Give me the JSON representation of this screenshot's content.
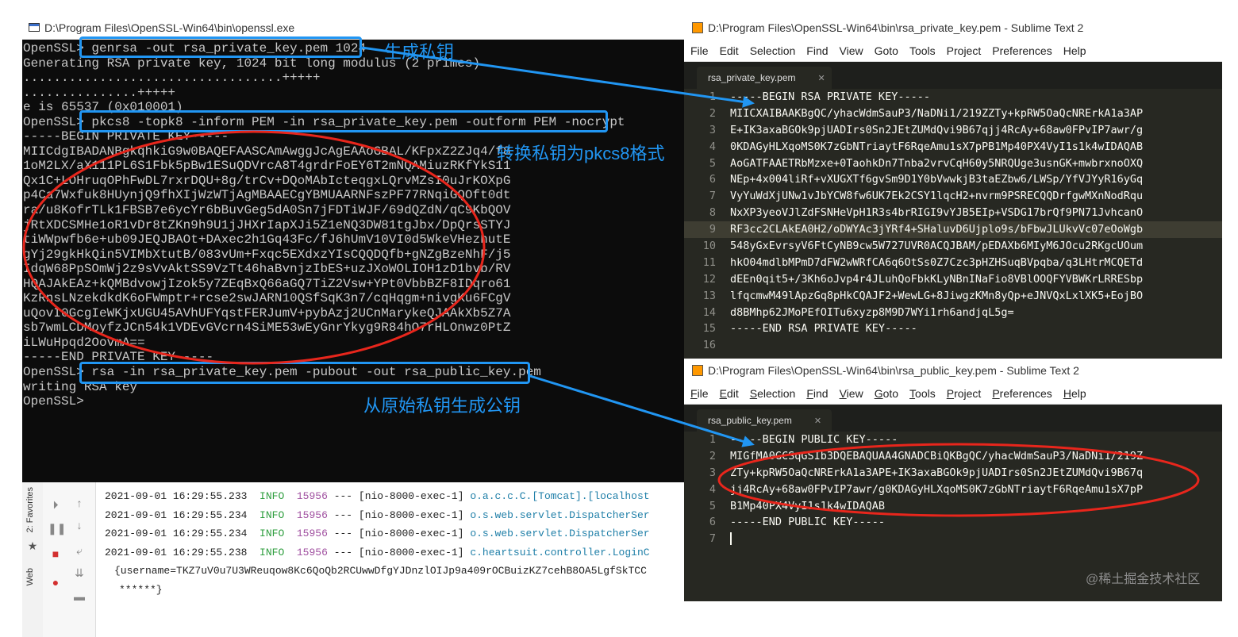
{
  "cmd": {
    "title": "D:\\Program Files\\OpenSSL-Win64\\bin\\openssl.exe",
    "lines": [
      "OpenSSL> genrsa -out rsa_private_key.pem 1024",
      "Generating RSA private key, 1024 bit long modulus (2 primes)",
      "..................................+++++",
      "...............+++++",
      "e is 65537 (0x010001)",
      "OpenSSL> pkcs8 -topk8 -inform PEM -in rsa_private_key.pem -outform PEM -nocrypt",
      "-----BEGIN PRIVATE KEY-----",
      "MIICdgIBADANBgkqhkiG9w0BAQEFAASCAmAwggJcAgEAAoGBAL/KFpxZ2ZJq4/f8",
      "1oM2LX/aX111PL6S1Fbk5pBw1ESuQDVrcA8T4grdrFoEY6T2mNQAMiuzRKfYkS11",
      "Qx1C+LOHruqOPhFwDL7rxrDQU+8g/trCv+DQoMAbIcteqgxLQrvMZsI0uJrKOXpG",
      "p4Ca7Wxfuk8HUynjQ9fhXIjWzWTjAgMBAAECgYBMUAARNFszPF77RNqiGQOft0dt",
      "ra/u8KofrTLk1FBSB7e6ycYr6bBuvGeg5dA0Sn7jFDTiWJF/69dQZdN/qC9KbQOV",
      "jRtXDCSMHe1oR1vDr8tZKn9h9U1jJHXrIapXJi5Z1eNQ3DW81tgJbx/DpQrsSTYJ",
      "tiWWpwfb6e+ub09JEQJBAOt+DAxec2h1Gq43Fc/fJ6hUmV10VI0d5WkeVHezhutE",
      "gYj29gkHkQin5VIMbXtutB/083vUm+Fxqc5EXdxzYIsCQQDQfb+gNZgBzeNhF/j5",
      "IdqW68PpSOmWj2z9sVvAktSS9VzTt46haBvnjzIbES+uzJXoWOLIOH1zD1bvb/RV",
      "HQAJAkEAz+kQMBdvowjIzok5y7ZEqBxQ66aGQ7TiZ2Vsw+YPt0VbbBZF8IDqro61",
      "KzRnsLNzekdkdK6oFWmptr+rcse2swJARN10QSfSqK3n7/cqHqgm+nivgKu6FCgV",
      "uQovI0GcgIeWKjxUGU45AVhUFYqstFERJumV+pybAzj2UCnMarykeQJAAkXb5Z7A",
      "sb7wmLCDMoyfzJCn54k1VDEvGVcrn4SiME53wEyGnrYkyg9R84hO7rHLOnwz0PtZ",
      "iLWuHpqd2OovmA==",
      "-----END PRIVATE KEY-----",
      "OpenSSL> rsa -in rsa_private_key.pem -pubout -out rsa_public_key.pem",
      "writing RSA key",
      "OpenSSL>"
    ]
  },
  "annotations": {
    "gen_private": "生成私钥",
    "to_pkcs8": "转换私钥为pkcs8格式",
    "gen_public": "从原始私钥生成公钥"
  },
  "ide": {
    "tabs": [
      "2: Favorites",
      "Web"
    ],
    "logs": [
      {
        "ts": "2021-09-01 16:29:55.233",
        "level": "INFO",
        "pid": "15956",
        "thread": " --- [nio-8000-exec-1] ",
        "logger": "o.a.c.c.C.[Tomcat].[localhost"
      },
      {
        "ts": "2021-09-01 16:29:55.234",
        "level": "INFO",
        "pid": "15956",
        "thread": " --- [nio-8000-exec-1] ",
        "logger": "o.s.web.servlet.DispatcherSer"
      },
      {
        "ts": "2021-09-01 16:29:55.234",
        "level": "INFO",
        "pid": "15956",
        "thread": " --- [nio-8000-exec-1] ",
        "logger": "o.s.web.servlet.DispatcherSer"
      },
      {
        "ts": "2021-09-01 16:29:55.238",
        "level": "INFO",
        "pid": "15956",
        "thread": " --- [nio-8000-exec-1] ",
        "logger": "c.heartsuit.controller.LoginC"
      }
    ],
    "payload": "{username=TKZ7uV0u7U3WReuqow8Kc6QoQb2RCUwwDfgYJDnzlOIJp9a409rOCBuizKZ7cehB8OA5LgfSkTCC",
    "payload2": "******}"
  },
  "sublime_private": {
    "title": "D:\\Program Files\\OpenSSL-Win64\\bin\\rsa_private_key.pem - Sublime Text 2",
    "menu": [
      "File",
      "Edit",
      "Selection",
      "Find",
      "View",
      "Goto",
      "Tools",
      "Project",
      "Preferences",
      "Help"
    ],
    "tab": "rsa_private_key.pem",
    "lines": [
      "-----BEGIN RSA PRIVATE KEY-----",
      "MIICXAIBAAKBgQC/yhacWdmSauP3/NaDNi1/219ZZTy+kpRW5OaQcNRErkA1a3AP",
      "E+IK3axaBGOk9pjUADIrs0Sn2JEtZUMdQvi9B67qjj4RcAy+68aw0FPvIP7awr/g",
      "0KDAGyHLXqoMS0K7zGbNTriaytF6RqeAmu1sX7pPB1Mp40PX4VyI1s1k4wIDAQAB",
      "AoGATFAAETRbMzxe+0TaohkDn7Tnba2vrvCqH60y5NRQUge3usnGK+mwbrxnoOXQ",
      "NEp+4x004liRf+vXUGXTf6gvSm9D1Y0bVwwkjB3taEZbw6/LWSp/YfVJYyR16yGq",
      "VyYuWdXjUNw1vJbYCW8fw6UK7Ek2CSY1lqcH2+nvrm9PSRECQQDrfgwMXnNodRqu",
      "NxXP3yeoVJlZdFSNHeVpH1R3s4brRIGI9vYJB5EIp+VSDG17brQf9PN71JvhcanO",
      "RF3cc2CLAkEA0H2/oDWYAc3jYRf4+SHaluvD6Ujplo9s/bFbwJLUkvVc07eOoWgb",
      "548yGxEvrsyV6FtCyNB9cw5W727UVR0ACQJBAM/pEDAXb6MIyM6JOcu2RKgcUOum",
      "hkO04mdlbMPmD7dFW2wWRfCA6q6OtSs0Z7Czc3pHZHSuqBVpqba/q3LHtrMCQETd",
      "dEEn0qit5+/3Kh6oJvp4r4JLuhQoFbkKLyNBnINaFio8VBlOOQFYVBWKrLRRESbp",
      "lfqcmwM49lApzGq8pHkCQAJF2+WewLG+8JiwgzKMn8yQp+eJNVQxLxlXK5+EojBO",
      "d8BMhp62JMoPEfOITu6xyzp8M9D7WYi1rh6andjqL5g=",
      "-----END RSA PRIVATE KEY-----",
      ""
    ],
    "highlight_line": 9
  },
  "sublime_public": {
    "title": "D:\\Program Files\\OpenSSL-Win64\\bin\\rsa_public_key.pem - Sublime Text 2",
    "menu": [
      "File",
      "Edit",
      "Selection",
      "Find",
      "View",
      "Goto",
      "Tools",
      "Project",
      "Preferences",
      "Help"
    ],
    "tab": "rsa_public_key.pem",
    "lines": [
      "-----BEGIN PUBLIC KEY-----",
      "MIGfMA0GCSqGSIb3DQEBAQUAA4GNADCBiQKBgQC/yhacWdmSauP3/NaDNi1/219Z",
      "ZTy+kpRW5OaQcNRErkA1a3APE+IK3axaBGOk9pjUADIrs0Sn2JEtZUMdQvi9B67q",
      "jj4RcAy+68aw0FPvIP7awr/g0KDAGyHLXqoMS0K7zGbNTriaytF6RqeAmu1sX7pP",
      "B1Mp40PX4VyI1s1k4wIDAQAB",
      "-----END PUBLIC KEY-----",
      ""
    ]
  },
  "watermark": "@稀土掘金技术社区",
  "colors": {
    "annotation_blue": "#2196f3",
    "annotation_red": "#e8261c"
  }
}
